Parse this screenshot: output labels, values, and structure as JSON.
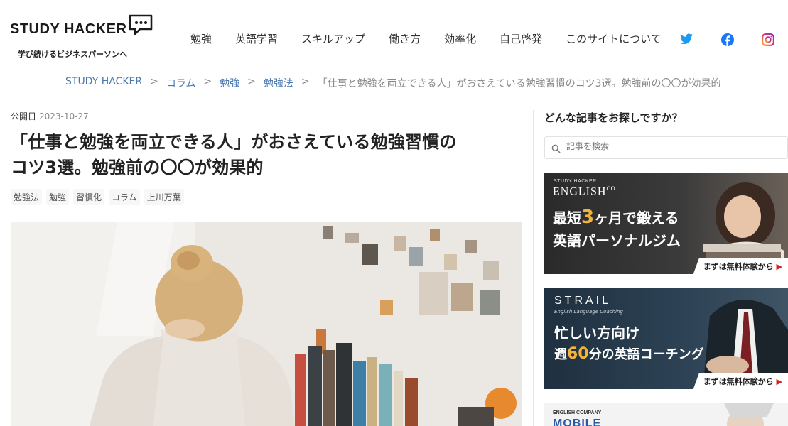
{
  "header": {
    "logo_text": "STUDY HACKER",
    "tagline": "学び続けるビジネスパーソンへ",
    "nav": [
      "勉強",
      "英語学習",
      "スキルアップ",
      "働き方",
      "効率化",
      "自己啓発",
      "このサイトについて"
    ],
    "social": [
      "twitter-icon",
      "facebook-icon",
      "instagram-icon"
    ],
    "colors": {
      "twitter": "#1d9bf0",
      "facebook": "#1877f2",
      "instagram": "#d6249f"
    }
  },
  "breadcrumb": {
    "items": [
      "STUDY HACKER",
      "コラム",
      "勉強",
      "勉強法"
    ],
    "separator": ">",
    "current": "「仕事と勉強を両立できる人」がおさえている勉強習慣のコツ3選。勉強前の〇〇が効果的"
  },
  "article": {
    "published_label": "公開日",
    "published_date": "2023-10-27",
    "title_line1": "「仕事と勉強を両立できる人」がおさえている勉強習慣の",
    "title_line2": "コツ3選。勉強前の〇〇が効果的",
    "tags": [
      "勉強法",
      "勉強",
      "習慣化",
      "コラム",
      "上川万葉"
    ]
  },
  "sidebar": {
    "heading": "どんな記事をお探しですか？",
    "search_placeholder": "記事を検索",
    "banner1": {
      "brand_small": "STUDY HACKER",
      "brand": "ENGLISH",
      "brand_suffix": "CO.",
      "line1_a": "最短",
      "line1_num": "3",
      "line1_b": "ヶ月で鍛える",
      "line2": "英語パーソナルジム",
      "cta": "まずは無料体験から",
      "cta_arrow": "▶"
    },
    "banner2": {
      "brand": "STRAIL",
      "sub": "English Language Coaching",
      "line1": "忙しい方向け",
      "line2_a": "週",
      "line2_num": "60",
      "line2_b": "分の英語コーチング",
      "cta": "まずは無料体験から",
      "cta_arrow": "▶"
    },
    "banner3": {
      "brand_small": "ENGLISH COMPANY",
      "brand": "MOBILE"
    }
  }
}
